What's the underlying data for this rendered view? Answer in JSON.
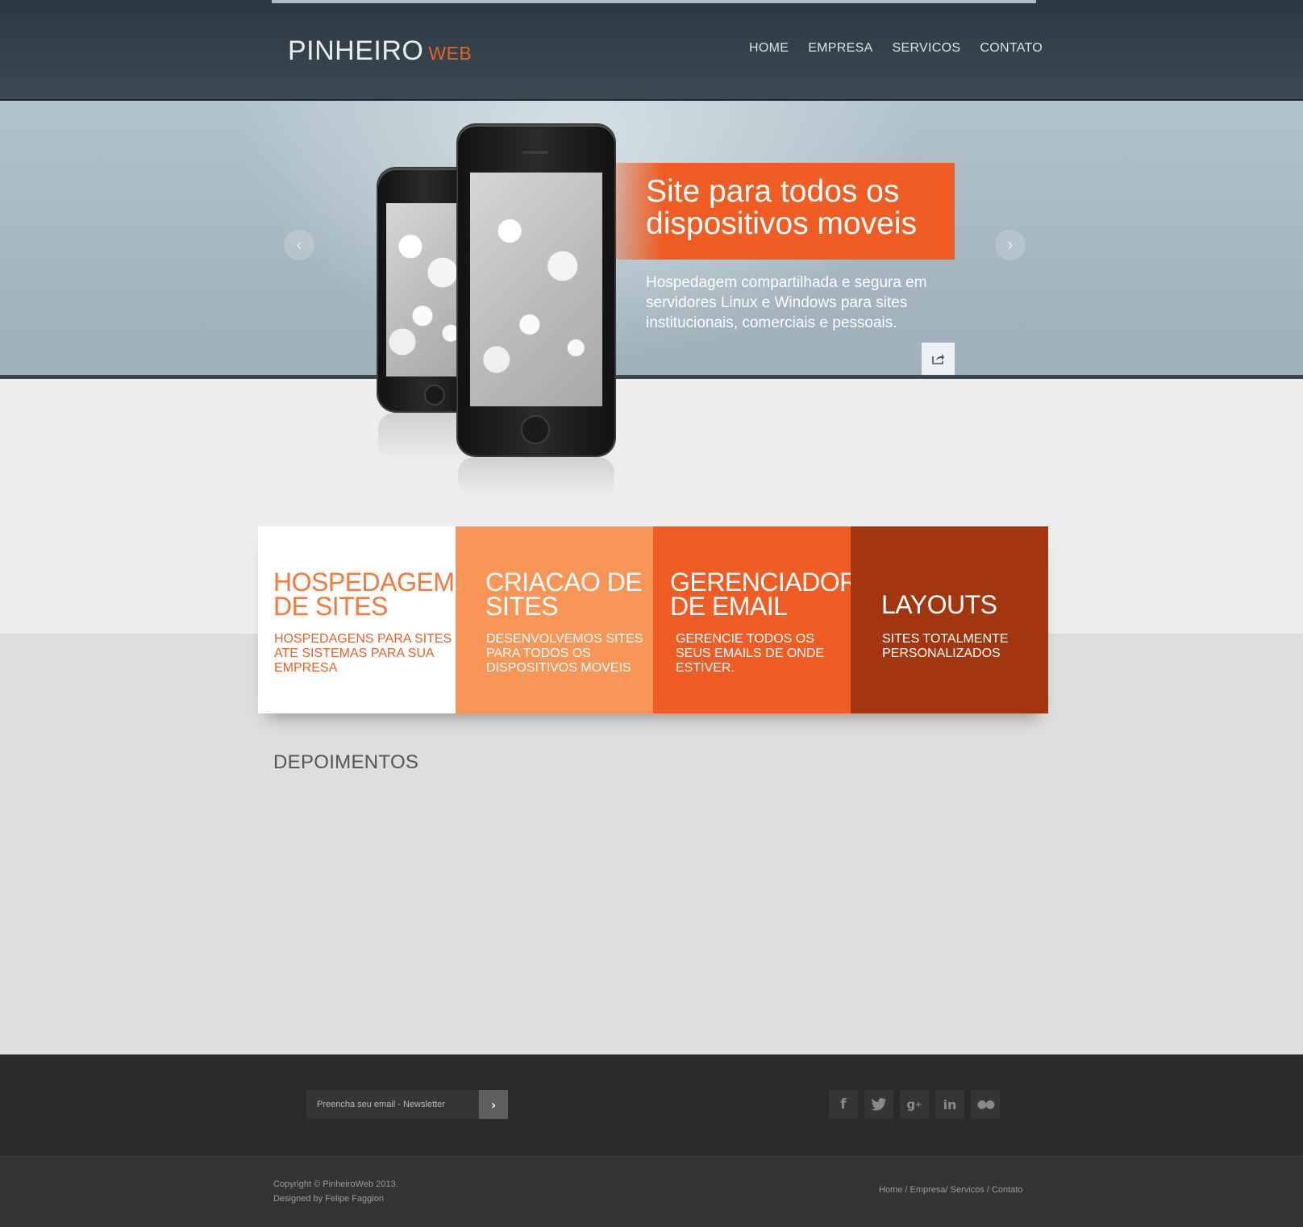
{
  "header": {
    "logo_main": "PINHEIRO",
    "logo_accent": "WEB",
    "nav": [
      "HOME",
      "EMPRESA",
      "SERVICOS",
      "CONTATO"
    ]
  },
  "hero": {
    "title": "Site para todos os dispositivos moveis",
    "description": "Hospedagem compartilhada e segura em servidores Linux e Windows para sites institucionais, comerciais e pessoais.",
    "prev_icon": "chevron-left-icon",
    "next_icon": "chevron-right-icon",
    "share_icon": "share-icon"
  },
  "services": [
    {
      "title": "HOSPEDAGEM DE SITES",
      "text": "HOSPEDAGENS PARA SITES ATE SISTEMAS PARA SUA EMPRESA"
    },
    {
      "title": "CRIACAO DE SITES",
      "text": "DESENVOLVEMOS SITES PARA TODOS OS DISPOSITIVOS MOVEIS"
    },
    {
      "title": "GERENCIADOR DE EMAIL",
      "text": "GERENCIE TODOS OS SEUS EMAILS DE ONDE ESTIVER."
    },
    {
      "title": "LAYOUTS",
      "text": "SITES TOTALMENTE PERSONALIZADOS"
    }
  ],
  "testimonials": {
    "title": "DEPOIMENTOS"
  },
  "footer": {
    "newsletter_placeholder": "Preencha seu email - Newsletter",
    "social": [
      "facebook-icon",
      "twitter-icon",
      "google-plus-icon",
      "linkedin-icon",
      "flickr-icon"
    ],
    "copyright_line1": "Copyright © PinheiroWeb 2013.",
    "copyright_line2": "Designed by Felipe Faggion",
    "links": "Home / Empresa/ Servicos / Contato"
  },
  "colors": {
    "accent": "#f05d24",
    "tile_light": "#f79657",
    "tile_dark": "#a3360e",
    "header_bg": "#34424b"
  }
}
